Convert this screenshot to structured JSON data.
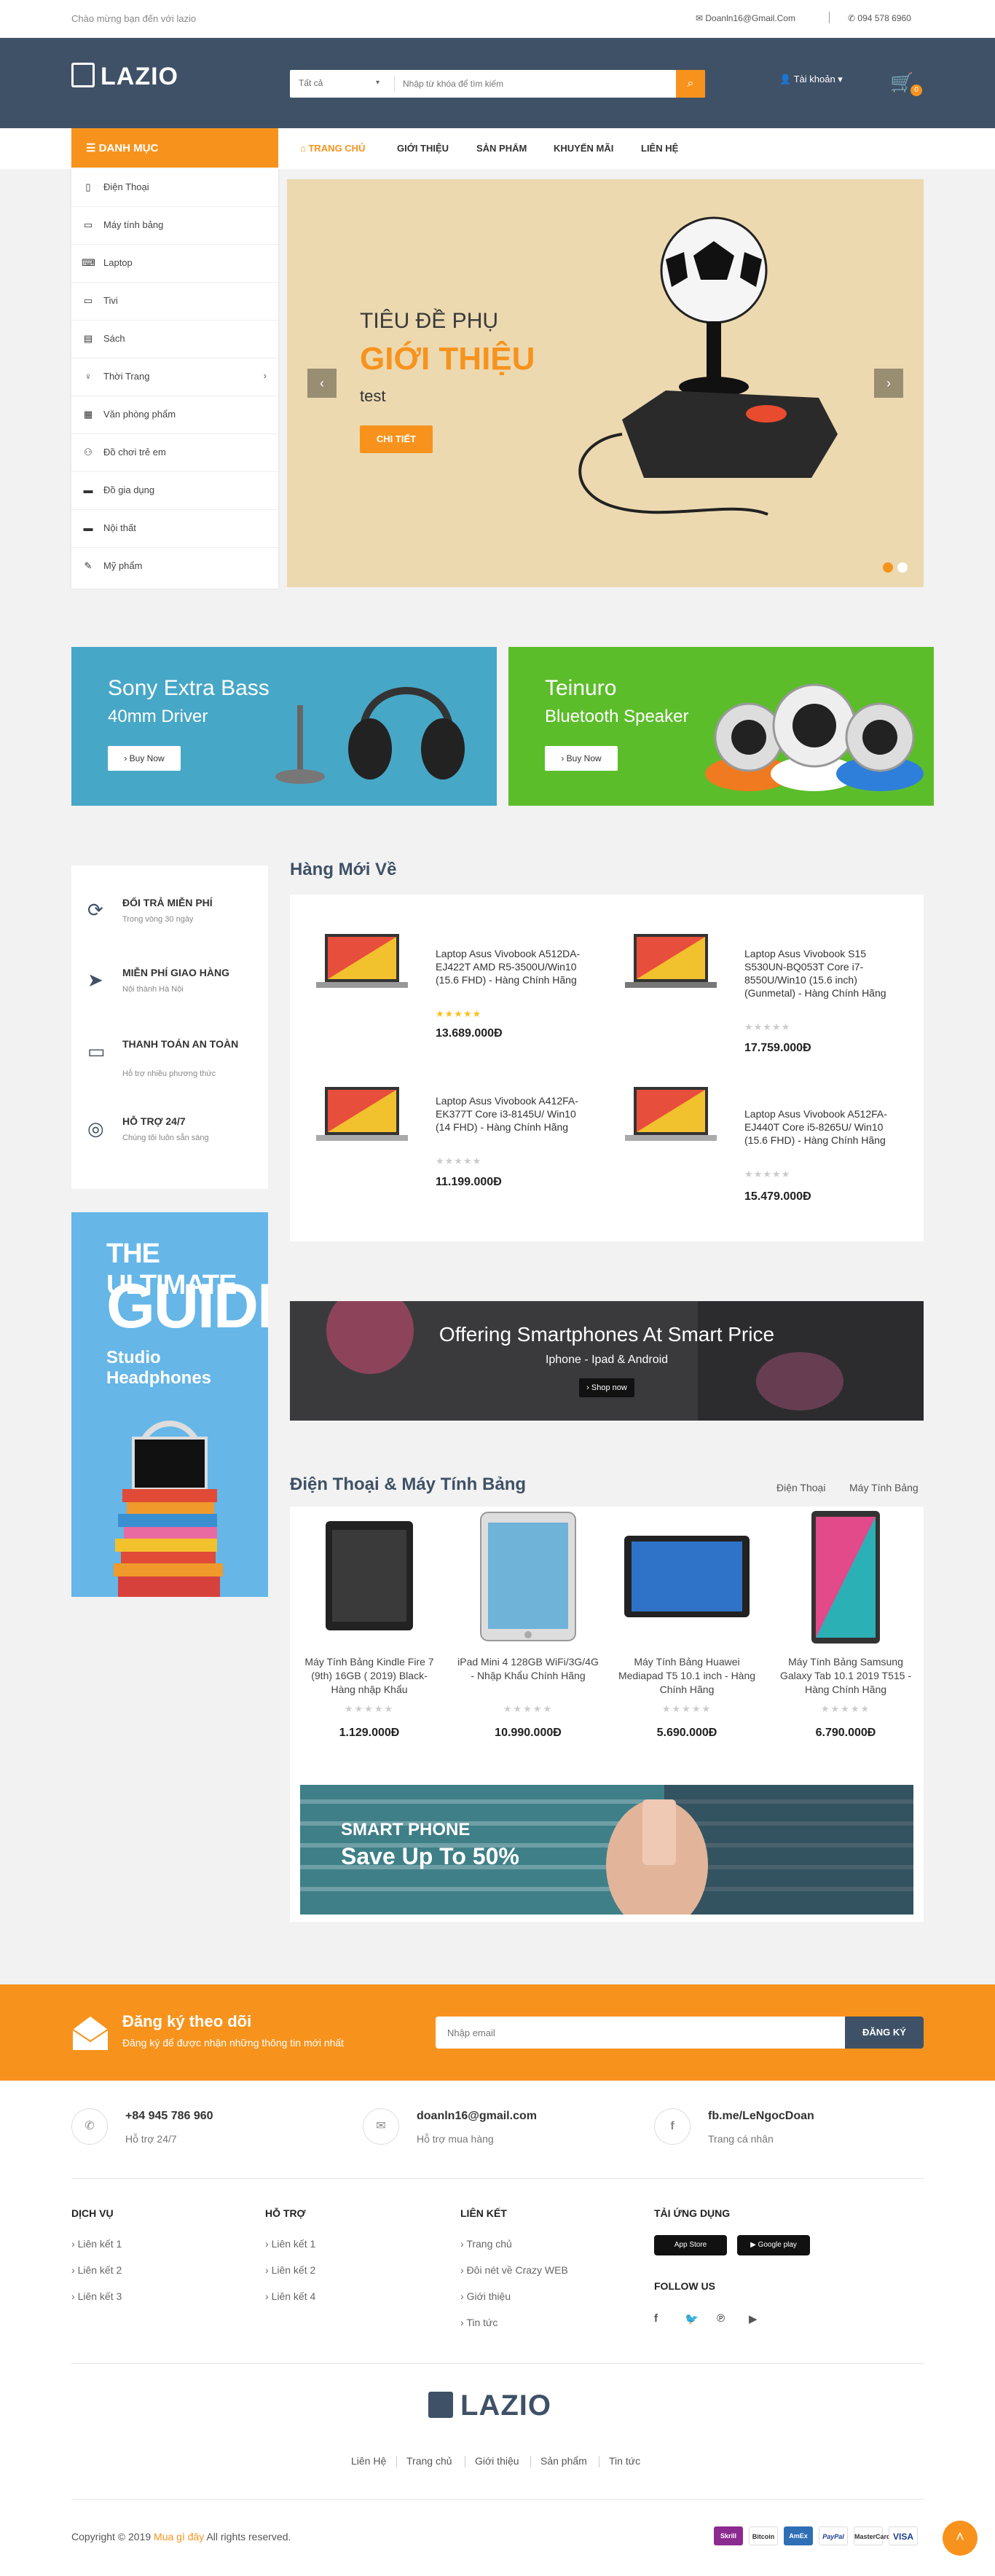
{
  "topbar": {
    "welcome": "Chào mừng bạn đến với lazio",
    "email": "Doanln16@Gmail.Com",
    "phone": "094 578 6960"
  },
  "header": {
    "logo": "LAZIO",
    "search_category": "Tất cả",
    "search_placeholder": "Nhập từ khóa để tìm kiếm",
    "account_label": "Tài khoản",
    "cart_count": "0"
  },
  "nav": {
    "category_label": "DANH MỤC",
    "items": [
      "TRANG CHỦ",
      "GIỚI THIỆU",
      "SẢN PHẨM",
      "KHUYẾN MÃI",
      "LIÊN HỆ"
    ]
  },
  "sidebar": {
    "items": [
      {
        "label": "Điện Thoại",
        "icon": "phone-icon"
      },
      {
        "label": "Máy tính bảng",
        "icon": "tablet-icon"
      },
      {
        "label": "Laptop",
        "icon": "laptop-icon"
      },
      {
        "label": "Tivi",
        "icon": "tv-icon"
      },
      {
        "label": "Sách",
        "icon": "book-icon"
      },
      {
        "label": "Thời Trang",
        "icon": "fashion-icon"
      },
      {
        "label": "Văn phòng phẩm",
        "icon": "stationery-icon"
      },
      {
        "label": "Đồ chơi trẻ em",
        "icon": "toy-icon"
      },
      {
        "label": "Đồ gia dụng",
        "icon": "appliance-icon"
      },
      {
        "label": "Nội thất",
        "icon": "furniture-icon"
      },
      {
        "label": "Mỹ phẩm",
        "icon": "cosmetics-icon"
      }
    ]
  },
  "slider": {
    "title": "TIÊU ĐỀ PHỤ",
    "subtitle": "GIỚI THIỆU",
    "description": "test",
    "button": "CHI TIẾT"
  },
  "banners": [
    {
      "title": "Sony Extra Bass",
      "subtitle": "40mm Driver",
      "button": "› Buy Now"
    },
    {
      "title": "Teinuro",
      "subtitle": "Bluetooth Speaker",
      "button": "› Buy Now"
    }
  ],
  "policies": [
    {
      "title": "ĐỔI TRẢ MIỄN PHÍ",
      "desc": "Trong vòng 30 ngày"
    },
    {
      "title": "MIỄN PHÍ GIAO HÀNG",
      "desc": "Nội thành Hà Nội"
    },
    {
      "title": "THANH TOÁN AN TOÀN",
      "desc": "Hỗ trợ nhiều phương thức"
    },
    {
      "title": "HỖ TRỢ 24/7",
      "desc": "Chúng tôi luôn sẵn sàng"
    }
  ],
  "guide": {
    "line1": "THE ULTIMATE",
    "line2": "GUIDE",
    "line3": "Studio Headphones"
  },
  "new_products": {
    "title": "Hàng Mới Về",
    "items": [
      {
        "name": "Laptop Asus Vivobook A512DA-EJ422T AMD R5-3500U/Win10 (15.6 FHD) - Hàng Chính Hãng",
        "rating": 5,
        "price": "13.689.000Đ"
      },
      {
        "name": "Laptop Asus Vivobook S15 S530UN-BQ053T Core i7-8550U/Win10 (15.6 inch) (Gunmetal) - Hàng Chính Hãng",
        "rating": 0,
        "price": "17.759.000Đ"
      },
      {
        "name": "Laptop Asus Vivobook A412FA-EK377T Core i3-8145U/ Win10 (14 FHD) - Hàng Chính Hãng",
        "rating": 0,
        "price": "11.199.000Đ"
      },
      {
        "name": "Laptop Asus Vivobook A512FA-EJ440T Core i5-8265U/ Win10 (15.6 FHD) - Hàng Chính Hãng",
        "rating": 0,
        "price": "15.479.000Đ"
      }
    ]
  },
  "phone_banner": {
    "title": "Offering Smartphones At Smart Price",
    "subtitle": "Iphone - Ipad & Android",
    "button": "› Shop now"
  },
  "phones": {
    "title": "Điện Thoại & Máy Tính Bảng",
    "tabs": [
      "Điện Thoại",
      "Máy Tính Bảng"
    ],
    "items": [
      {
        "name": "Máy Tính Bảng Kindle Fire 7 (9th) 16GB ( 2019) Black- Hàng nhập Khẩu",
        "price": "1.129.000Đ"
      },
      {
        "name": "iPad Mini 4 128GB WiFi/3G/4G - Nhập Khẩu Chính Hãng",
        "price": "10.990.000Đ"
      },
      {
        "name": "Máy Tính Bảng Huawei Mediapad T5 10.1 inch - Hàng Chính Hãng",
        "price": "5.690.000Đ"
      },
      {
        "name": "Máy Tính Bảng Samsung Galaxy Tab 10.1 2019 T515 - Hàng Chính Hãng",
        "price": "6.790.000Đ"
      }
    ]
  },
  "smart_banner": {
    "line1": "SMART PHONE",
    "line2": "Save Up To 50%"
  },
  "subscribe": {
    "title": "Đăng ký theo dõi",
    "desc": "Đăng ký để được nhận những thông tin mới nhất",
    "placeholder": "Nhập email",
    "button": "ĐĂNG KÝ"
  },
  "contacts": [
    {
      "title": "+84 945 786 960",
      "desc": "Hỗ trợ 24/7"
    },
    {
      "title": "doanln16@gmail.com",
      "desc": "Hỗ trợ mua hàng"
    },
    {
      "title": "fb.me/LeNgocDoan",
      "desc": "Trang cá nhân"
    }
  ],
  "footer": {
    "col1": {
      "title": "DỊCH VỤ",
      "links": [
        "Liên kết 1",
        "Liên kết 2",
        "Liên kết 3"
      ]
    },
    "col2": {
      "title": "HỖ TRỢ",
      "links": [
        "Liên kết 1",
        "Liên kết 2",
        "Liên kết 4"
      ]
    },
    "col3": {
      "title": "LIÊN KẾT",
      "links": [
        "Trang chủ",
        "Đôi nét về Crazy WEB",
        "Giới thiệu",
        "Tin tức"
      ]
    },
    "apps_title": "TẢI ỨNG DỤNG",
    "app_store": "App Store",
    "google_play": "Google play",
    "follow_title": "FOLLOW US",
    "logo": "LAZIO",
    "bottom_links": [
      "Liên Hệ",
      "Trang chủ",
      "Giới thiệu",
      "Sản phẩm",
      "Tin tức"
    ],
    "copyright_pre": "Copyright © 2019",
    "copyright_link": "Mua gì đây",
    "copyright_post": "All rights reserved.",
    "payments": [
      "Skrill",
      "Bitcoin",
      "AmEx",
      "PayPal",
      "MasterCard",
      "VISA"
    ]
  },
  "colors": {
    "accent": "#f7931d",
    "header": "#3f5166",
    "blue_banner": "#47a7c7",
    "green_banner": "#5cbd2b"
  }
}
